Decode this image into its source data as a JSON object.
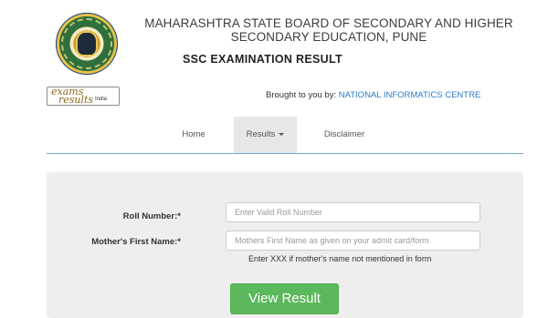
{
  "header": {
    "board_line1": "MAHARASHTRA STATE BOARD OF SECONDARY AND HIGHER",
    "board_line2": "SECONDARY EDUCATION, PUNE",
    "exam_title": "SSC EXAMINATION RESULT",
    "logo_icon": "board-seal-logo"
  },
  "brand": {
    "badge_line1": "exams",
    "badge_line2": "results",
    "badge_line3": "India",
    "brought_prefix": "Brought to you by:",
    "brought_org": "NATIONAL INFORMATICS CENTRE",
    "org_color": "#2a7bc4"
  },
  "nav": {
    "home": "Home",
    "results": "Results",
    "disclaimer": "Disclaimer",
    "active": "Results"
  },
  "form": {
    "roll_label": "Roll Number:*",
    "roll_placeholder": "Enter Valid Roll Number",
    "roll_value": "",
    "mother_label": "Mother's First Name:*",
    "mother_placeholder": "Mothers First Name as given on your admit card/form",
    "mother_value": "",
    "hint": "Enter XXX if mother's name not mentioned in form",
    "submit_label": "View Result",
    "submit_color": "#5cb85c"
  }
}
